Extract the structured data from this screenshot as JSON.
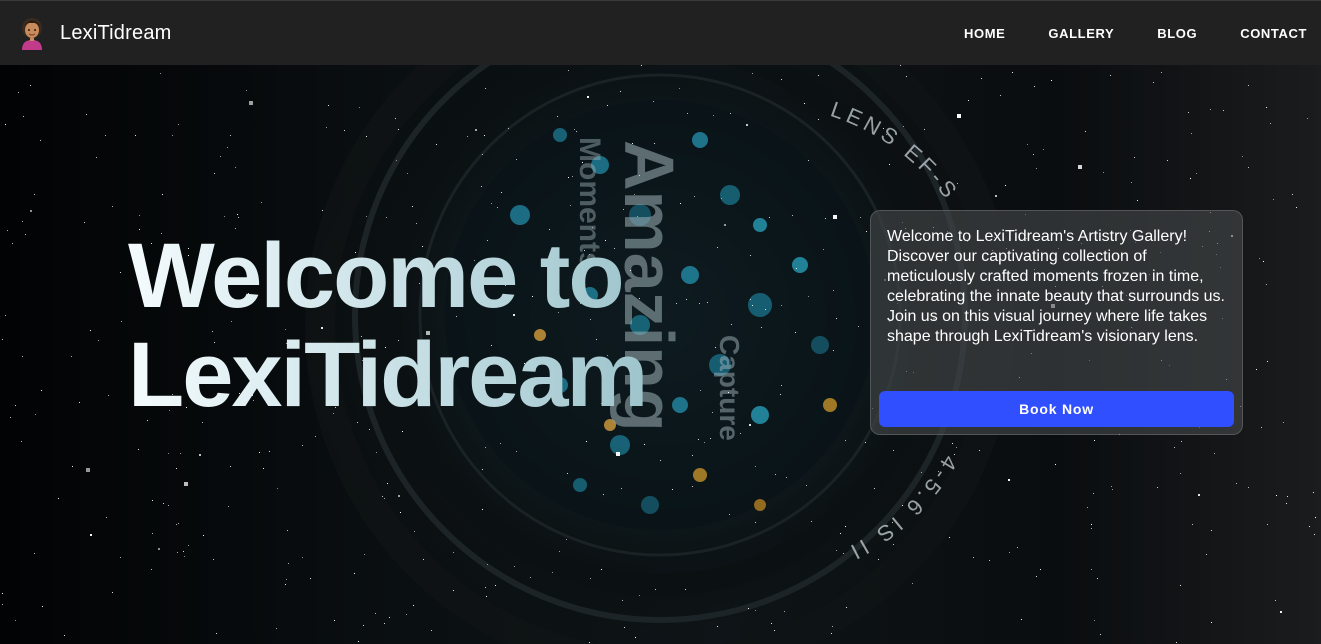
{
  "brand": {
    "name": "LexiTidream",
    "avatar_icon": "person-avatar-icon"
  },
  "nav": [
    {
      "label": "HOME"
    },
    {
      "label": "GALLERY"
    },
    {
      "label": "BLOG"
    },
    {
      "label": "CONTACT"
    }
  ],
  "hero": {
    "title_line1": "Welcome to",
    "title_line2": "LexiTidream",
    "lens_texts": [
      "Amazing",
      "Moments",
      "Capture",
      "LENS EF-S",
      "4-5.6 IS II"
    ]
  },
  "card": {
    "text": "Welcome to LexiTidream's Artistry Gallery! Discover our captivating collection of meticulously crafted moments frozen in time, celebrating the innate beauty that surrounds us. Join us on this visual journey where life takes shape through LexiTidream's visionary lens.",
    "button_label": "Book Now"
  },
  "colors": {
    "navbar": "#212121",
    "accent": "#304ffe",
    "title_gradient_start": "#f4fbfd",
    "title_gradient_end": "#9ec4cc"
  }
}
